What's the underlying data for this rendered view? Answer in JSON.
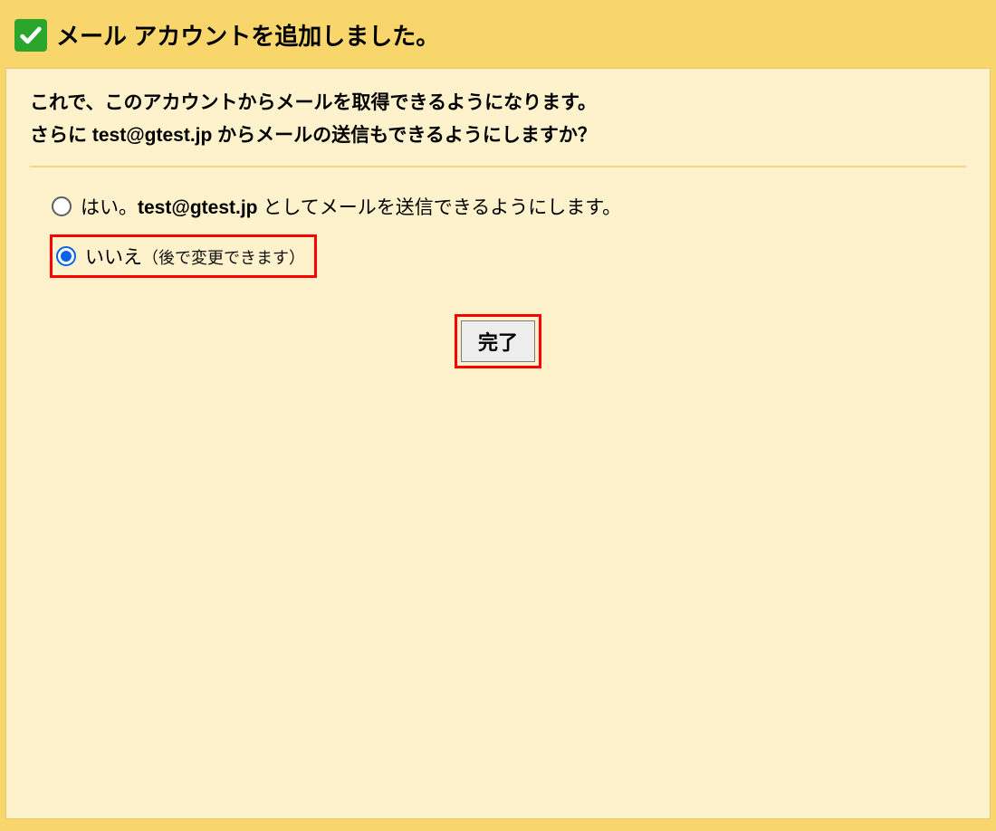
{
  "header": {
    "title": "メール アカウントを追加しました。"
  },
  "intro": {
    "line1": "これで、このアカウントからメールを取得できるようになります。",
    "line2_prefix": "さらに ",
    "line2_email": "test@gtest.jp",
    "line2_suffix": " からメールの送信もできるようにしますか？"
  },
  "options": {
    "yes": {
      "prefix": "はい。",
      "email": "test@gtest.jp",
      "suffix": " としてメールを送信できるようにします。"
    },
    "no": {
      "label": "いいえ",
      "note": "（後で変更できます）"
    }
  },
  "button": {
    "submit": "完了"
  }
}
